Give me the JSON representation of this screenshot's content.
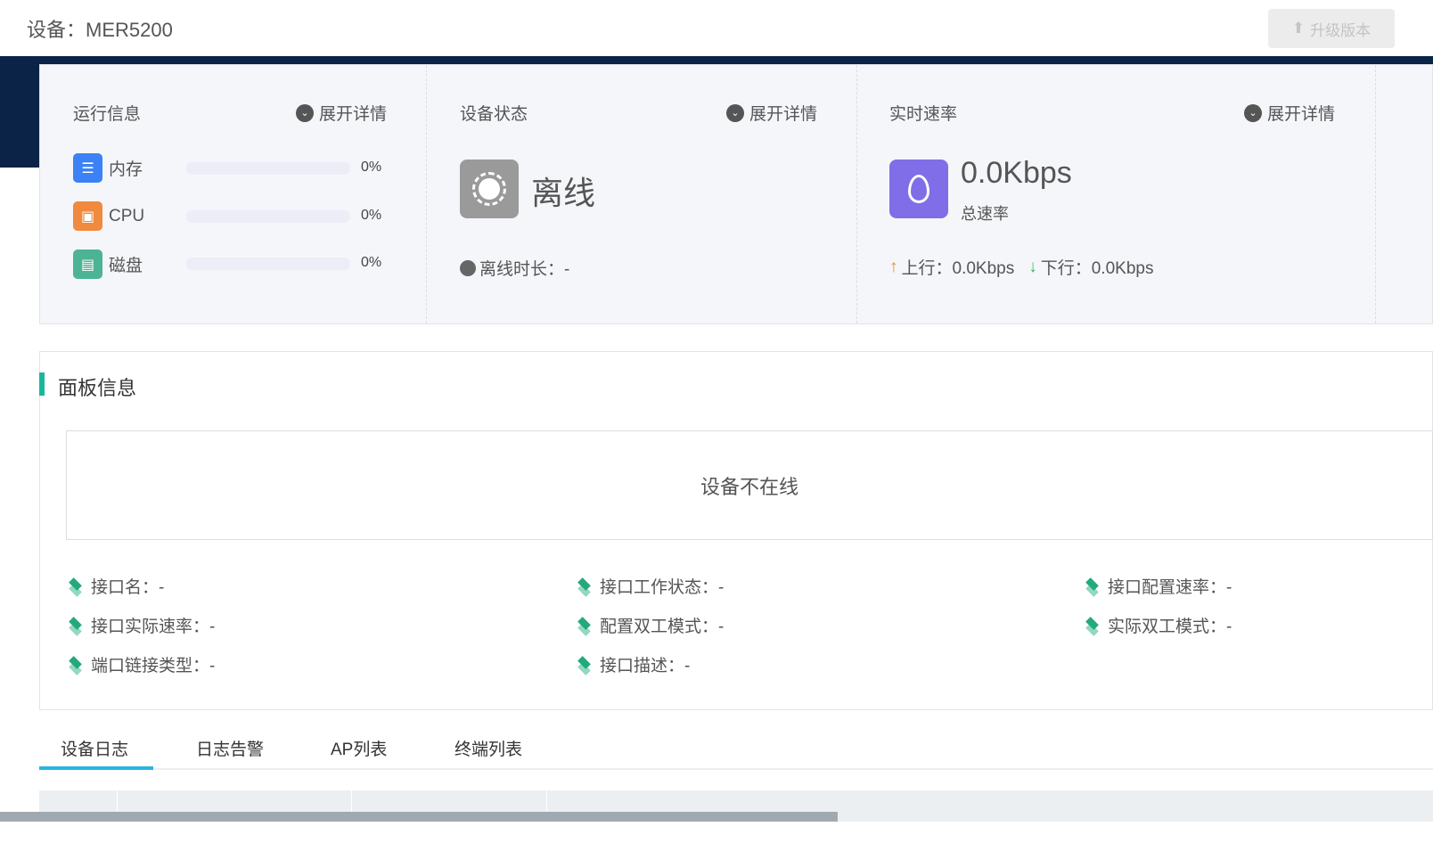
{
  "header": {
    "title": "设备：MER5200",
    "upgrade_label": "升级版本"
  },
  "runtime": {
    "title": "运行信息",
    "expand": "展开详情",
    "items": [
      {
        "label": "内存",
        "value": "0%",
        "percent": 0,
        "color": "#3b82f6"
      },
      {
        "label": "CPU",
        "value": "0%",
        "percent": 0,
        "color": "#ef8a3e"
      },
      {
        "label": "磁盘",
        "value": "0%",
        "percent": 0,
        "color": "#4db395"
      }
    ]
  },
  "status": {
    "title": "设备状态",
    "expand": "展开详情",
    "state": "离线",
    "duration": "离线时长：-"
  },
  "rate": {
    "title": "实时速率",
    "expand": "展开详情",
    "total": "0.0Kbps",
    "total_label": "总速率",
    "up": "上行：0.0Kbps",
    "down": "下行：0.0Kbps"
  },
  "panel": {
    "title": "面板信息",
    "offline_msg": "设备不在线",
    "attrs": [
      "接口名：-",
      "接口工作状态：-",
      "接口配置速率：-",
      "接口实际速率：-",
      "配置双工模式：-",
      "实际双工模式：-",
      "端口链接类型：-",
      "接口描述：-"
    ]
  },
  "tabs": [
    "设备日志",
    "日志告警",
    "AP列表",
    "终端列表"
  ]
}
